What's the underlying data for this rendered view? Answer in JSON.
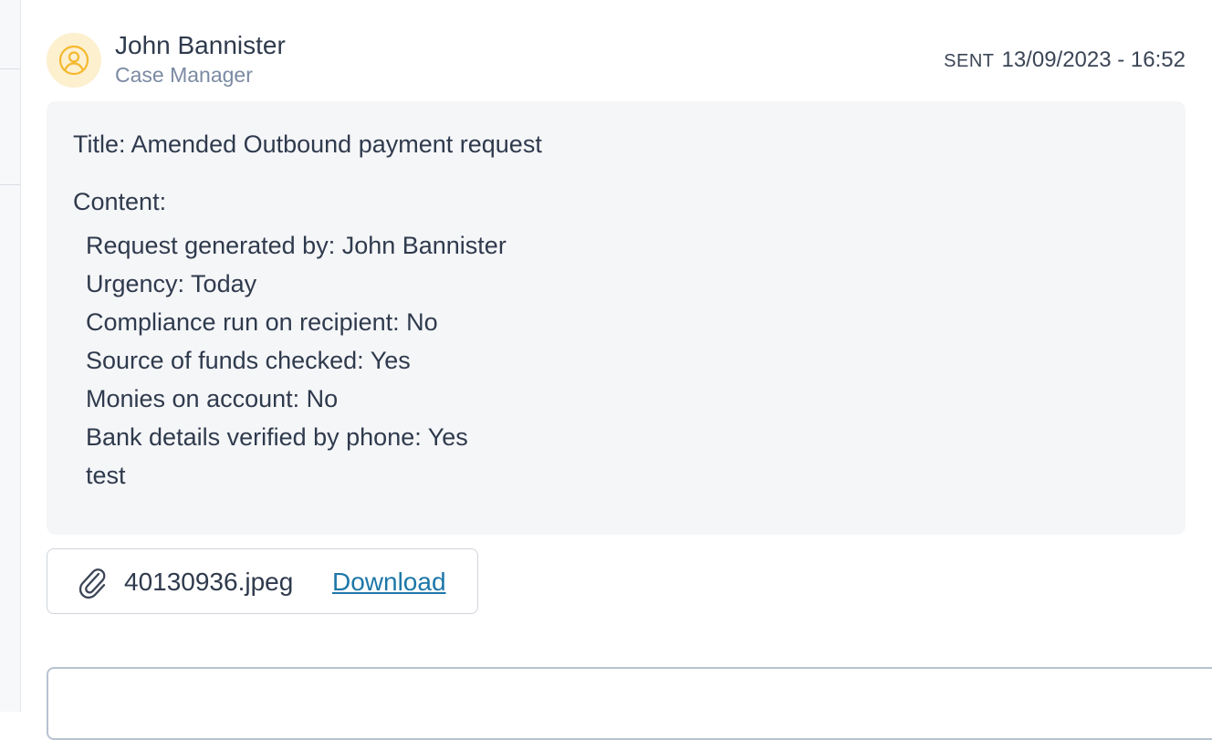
{
  "message": {
    "sender_name": "John Bannister",
    "sender_role": "Case Manager",
    "sent_label": "SENT",
    "sent_datetime": "13/09/2023 - 16:52",
    "avatar_icon": "user-circle-icon",
    "avatar_color": "#f5b82e",
    "title": "Title: Amended Outbound payment request",
    "content_label": "Content:",
    "content_lines": [
      "Request generated by: John Bannister",
      "Urgency: Today",
      "Compliance run on recipient: No",
      "Source of funds checked: Yes",
      "Monies on account: No",
      "Bank details verified by phone: Yes",
      "test"
    ]
  },
  "attachment": {
    "icon": "paperclip-icon",
    "file_name": "40130936.jpeg",
    "download_label": "Download",
    "link_color": "#1d77a8"
  },
  "reply": {
    "placeholder": ""
  }
}
